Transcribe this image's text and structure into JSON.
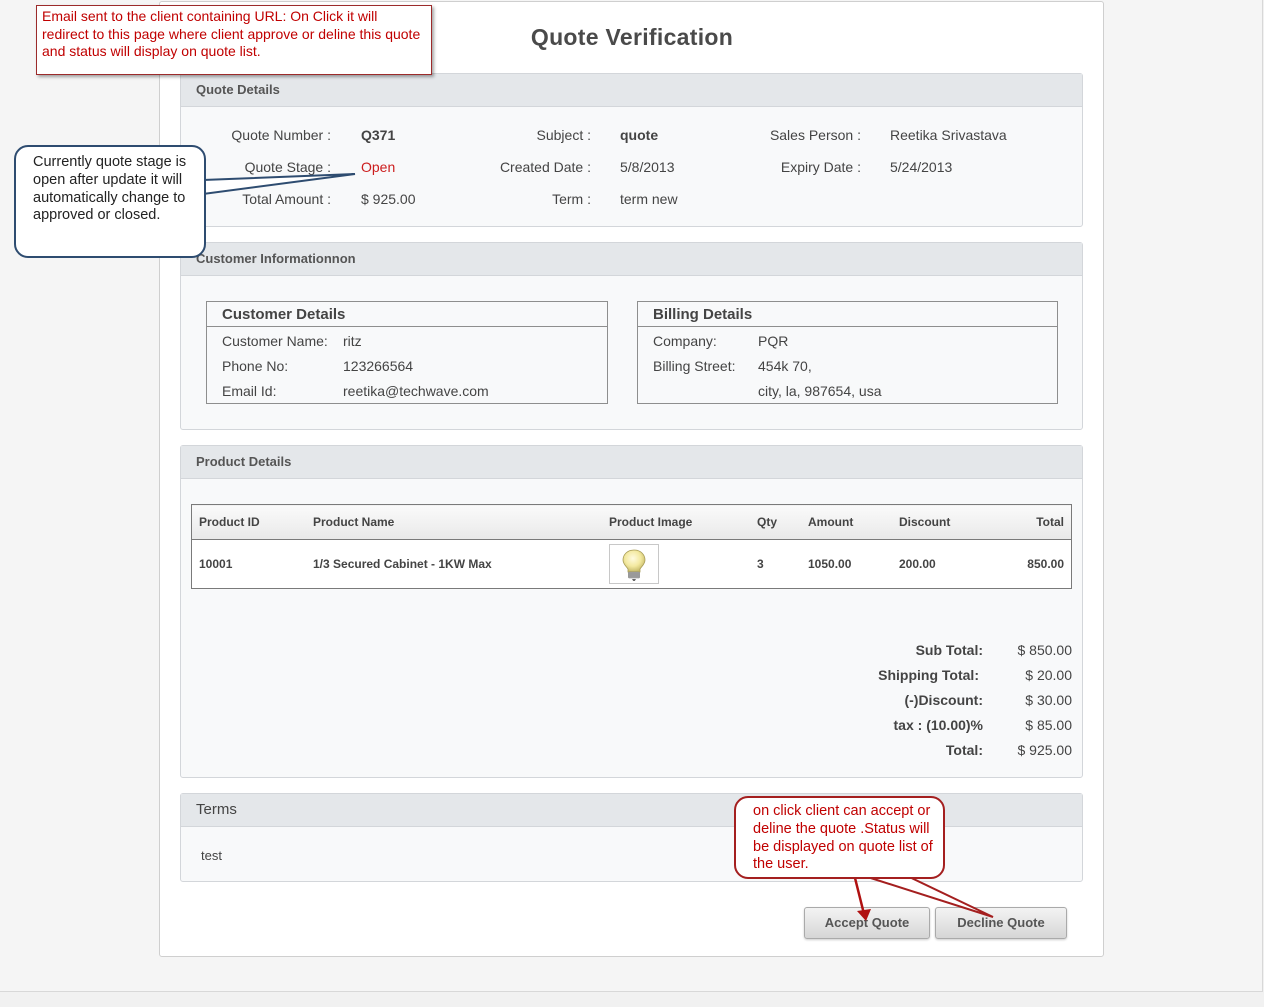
{
  "page": {
    "title": "Quote Verification"
  },
  "quote_details": {
    "header": "Quote Details",
    "quote_number": {
      "label": "Quote Number :",
      "value": "Q371"
    },
    "quote_stage": {
      "label": "Quote Stage :",
      "value": "Open"
    },
    "total_amount": {
      "label": "Total Amount :",
      "value": "$ 925.00"
    },
    "subject": {
      "label": "Subject :",
      "value": "quote"
    },
    "created_date": {
      "label": "Created Date :",
      "value": "5/8/2013"
    },
    "term": {
      "label": "Term :",
      "value": "term new"
    },
    "sales_person": {
      "label": "Sales Person :",
      "value": "Reetika Srivastava"
    },
    "expiry_date": {
      "label": "Expiry Date :",
      "value": "5/24/2013"
    }
  },
  "customer_info": {
    "header": "Customer Informationnon",
    "customer_details": {
      "title": "Customer Details",
      "name": {
        "label": "Customer Name:",
        "value": "ritz"
      },
      "phone": {
        "label": "Phone No:",
        "value": "123266564"
      },
      "email": {
        "label": "Email Id:",
        "value": "reetika@techwave.com"
      }
    },
    "billing_details": {
      "title": "Billing Details",
      "company": {
        "label": "Company:",
        "value": "PQR"
      },
      "street": {
        "label": "Billing Street:",
        "value": "454k 70,",
        "value2": "city, la, 987654, usa"
      }
    }
  },
  "product_details": {
    "header": "Product Details",
    "columns": [
      "Product ID",
      "Product Name",
      "Product Image",
      "Qty",
      "Amount",
      "Discount",
      "Total"
    ],
    "rows": [
      {
        "product_id": "10001",
        "product_name": "1/3 Secured Cabinet - 1KW Max",
        "image_icon": "light-bulb-icon",
        "qty": "3",
        "amount": "1050.00",
        "discount": "200.00",
        "total": "850.00"
      }
    ],
    "totals": {
      "sub_total": {
        "label": "Sub Total:",
        "value": "$ 850.00"
      },
      "shipping_total": {
        "label": "Shipping Total:",
        "value": "$ 20.00"
      },
      "discount": {
        "label": "(-)Discount:",
        "value": "$ 30.00"
      },
      "tax": {
        "label": "tax : (10.00)%",
        "value": "$ 85.00"
      },
      "total": {
        "label": "Total:",
        "value": "$ 925.00"
      }
    }
  },
  "terms": {
    "header": "Terms",
    "text": "test"
  },
  "actions": {
    "accept_label": "Accept Quote",
    "decline_label": "Decline Quote"
  },
  "annotations": {
    "email_note": "Email sent to the client containing URL: On Click it will redirect to this page where client approve or deline this quote and status will display on quote list.",
    "stage_note": "Currently quote stage is open after update it will automatically change to approved or closed.",
    "action_note": "on click client can accept or deline the quote .Status will be displayed on quote list of the user."
  },
  "colors": {
    "stage_open": "#cc1d1d",
    "annotation_red": "#c00000",
    "callout_blue_border": "#2e4c70"
  }
}
